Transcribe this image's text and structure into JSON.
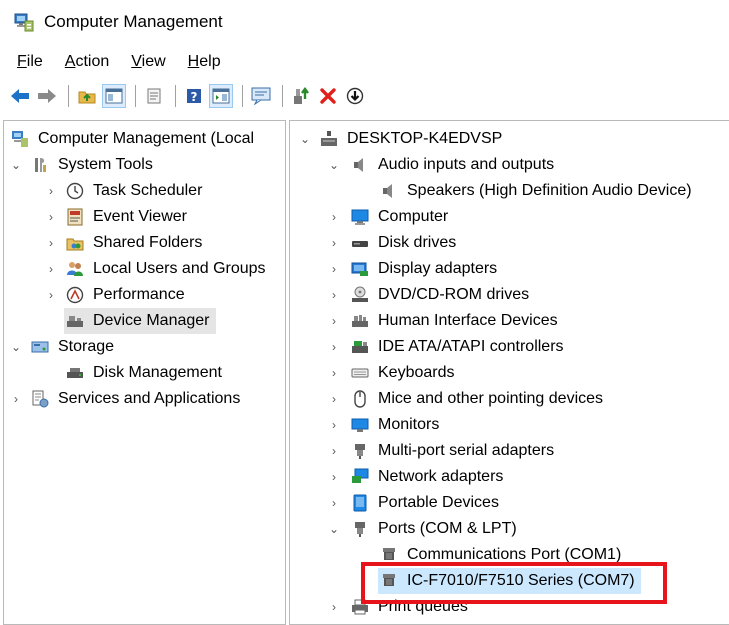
{
  "window": {
    "title": "Computer Management"
  },
  "menu": [
    {
      "accel": "F",
      "rest": "ile"
    },
    {
      "accel": "A",
      "rest": "ction"
    },
    {
      "accel": "V",
      "rest": "iew"
    },
    {
      "accel": "H",
      "rest": "elp"
    }
  ],
  "left_tree": {
    "root": "Computer Management (Local",
    "system_tools": "System Tools",
    "task_scheduler": "Task Scheduler",
    "event_viewer": "Event Viewer",
    "shared_folders": "Shared Folders",
    "local_users": "Local Users and Groups",
    "performance": "Performance",
    "device_manager": "Device Manager",
    "storage": "Storage",
    "disk_management": "Disk Management",
    "services": "Services and Applications"
  },
  "right_tree": {
    "computer_name": "DESKTOP-K4EDVSP",
    "audio": "Audio inputs and outputs",
    "speakers": "Speakers (High Definition Audio Device)",
    "computer": "Computer",
    "disk_drives": "Disk drives",
    "display_adapters": "Display adapters",
    "dvd": "DVD/CD-ROM drives",
    "hid": "Human Interface Devices",
    "ide": "IDE ATA/ATAPI controllers",
    "keyboards": "Keyboards",
    "mice": "Mice and other pointing devices",
    "monitors": "Monitors",
    "multiport": "Multi-port serial adapters",
    "network": "Network adapters",
    "portable": "Portable Devices",
    "ports": "Ports (COM & LPT)",
    "com1": "Communications Port (COM1)",
    "com7": "IC-F7010/F7510 Series (COM7)",
    "print_queues": "Print queues"
  },
  "colors": {
    "highlight_border": "#e8141c",
    "selection": "#cce8ff",
    "accent": "#0078d7"
  }
}
